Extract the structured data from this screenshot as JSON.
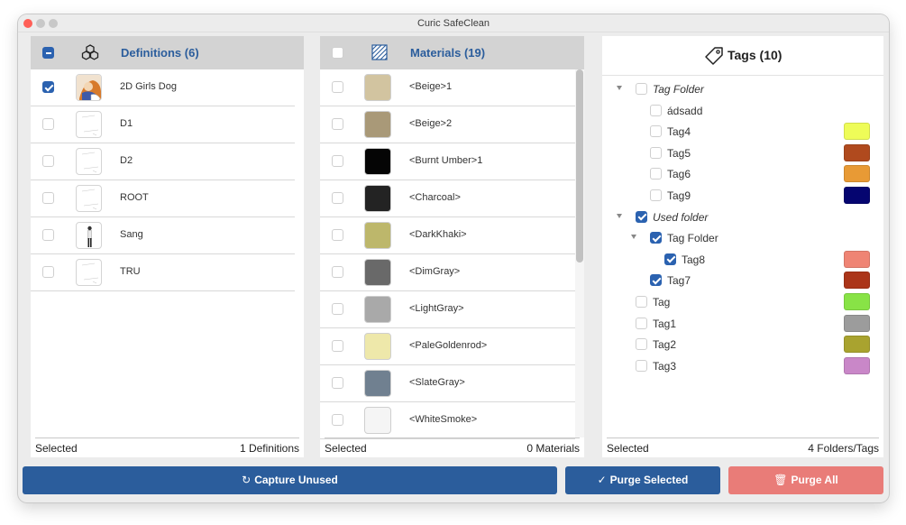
{
  "window": {
    "title": "Curic SafeClean",
    "traffic_colors": [
      "#ff5f57",
      "#c8c8c8",
      "#c8c8c8"
    ]
  },
  "definitions": {
    "header": "Definitions (6)",
    "items": [
      {
        "label": "2D Girls Dog",
        "checked": true,
        "thumb": "dog-thumbnail"
      },
      {
        "label": "D1",
        "checked": false,
        "thumb": "sketch-thumbnail"
      },
      {
        "label": "D2",
        "checked": false,
        "thumb": "sketch-thumbnail"
      },
      {
        "label": "ROOT",
        "checked": false,
        "thumb": "sketch-thumbnail"
      },
      {
        "label": "Sang",
        "checked": false,
        "thumb": "person-thumbnail"
      },
      {
        "label": "TRU",
        "checked": false,
        "thumb": "sketch-thumbnail"
      }
    ],
    "footer_left": "Selected",
    "footer_right": "1 Definitions"
  },
  "materials": {
    "header": "Materials (19)",
    "items": [
      {
        "label": "<Beige>1",
        "color": "#d2c4a0"
      },
      {
        "label": "<Beige>2",
        "color": "#a99978"
      },
      {
        "label": "<Burnt Umber>1",
        "color": "#050505"
      },
      {
        "label": "<Charcoal>",
        "color": "#232323"
      },
      {
        "label": "<DarkKhaki>",
        "color": "#bdb76b"
      },
      {
        "label": "<DimGray>",
        "color": "#696969"
      },
      {
        "label": "<LightGray>",
        "color": "#a9a9a9"
      },
      {
        "label": "<PaleGoldenrod>",
        "color": "#eee8aa"
      },
      {
        "label": "<SlateGray>",
        "color": "#708090"
      },
      {
        "label": "<WhiteSmoke>",
        "color": "#f5f5f5"
      }
    ],
    "footer_left": "Selected",
    "footer_right": "0 Materials"
  },
  "tags": {
    "header": "Tags (10)",
    "items": [
      {
        "label": "Tag Folder",
        "level": 0,
        "folder": true,
        "checked": false,
        "italic": true,
        "color": null
      },
      {
        "label": "ádsadd",
        "level": 1,
        "folder": false,
        "checked": false,
        "italic": false,
        "color": null
      },
      {
        "label": "Tag4",
        "level": 1,
        "folder": false,
        "checked": false,
        "italic": false,
        "color": "#eefc58"
      },
      {
        "label": "Tag5",
        "level": 1,
        "folder": false,
        "checked": false,
        "italic": false,
        "color": "#b04a1e"
      },
      {
        "label": "Tag6",
        "level": 1,
        "folder": false,
        "checked": false,
        "italic": false,
        "color": "#e89a35"
      },
      {
        "label": "Tag9",
        "level": 1,
        "folder": false,
        "checked": false,
        "italic": false,
        "color": "#050570"
      },
      {
        "label": "Used folder",
        "level": 0,
        "folder": true,
        "checked": true,
        "italic": true,
        "color": null
      },
      {
        "label": "Tag Folder",
        "level": 1,
        "folder": true,
        "checked": true,
        "italic": false,
        "color": null
      },
      {
        "label": "Tag8",
        "level": 2,
        "folder": false,
        "checked": true,
        "italic": false,
        "color": "#ef8474"
      },
      {
        "label": "Tag7",
        "level": 1,
        "folder": false,
        "checked": true,
        "italic": false,
        "color": "#ab3519"
      },
      {
        "label": "Tag",
        "level": 0,
        "folder": false,
        "checked": false,
        "italic": false,
        "color": "#88e346"
      },
      {
        "label": "Tag1",
        "level": 0,
        "folder": false,
        "checked": false,
        "italic": false,
        "color": "#9c9c9c"
      },
      {
        "label": "Tag2",
        "level": 0,
        "folder": false,
        "checked": false,
        "italic": false,
        "color": "#a9a32f"
      },
      {
        "label": "Tag3",
        "level": 0,
        "folder": false,
        "checked": false,
        "italic": false,
        "color": "#c987c8"
      }
    ],
    "footer_left": "Selected",
    "footer_right": "4 Folders/Tags"
  },
  "buttons": {
    "capture": "Capture Unused",
    "purge_selected": "Purge Selected",
    "purge_all": "Purge All",
    "capture_icon": "refresh-icon",
    "purge_selected_icon": "sweep-icon",
    "purge_all_icon": "trash-icon",
    "primary_color": "#2b5d9c",
    "danger_color": "#e97c78"
  }
}
